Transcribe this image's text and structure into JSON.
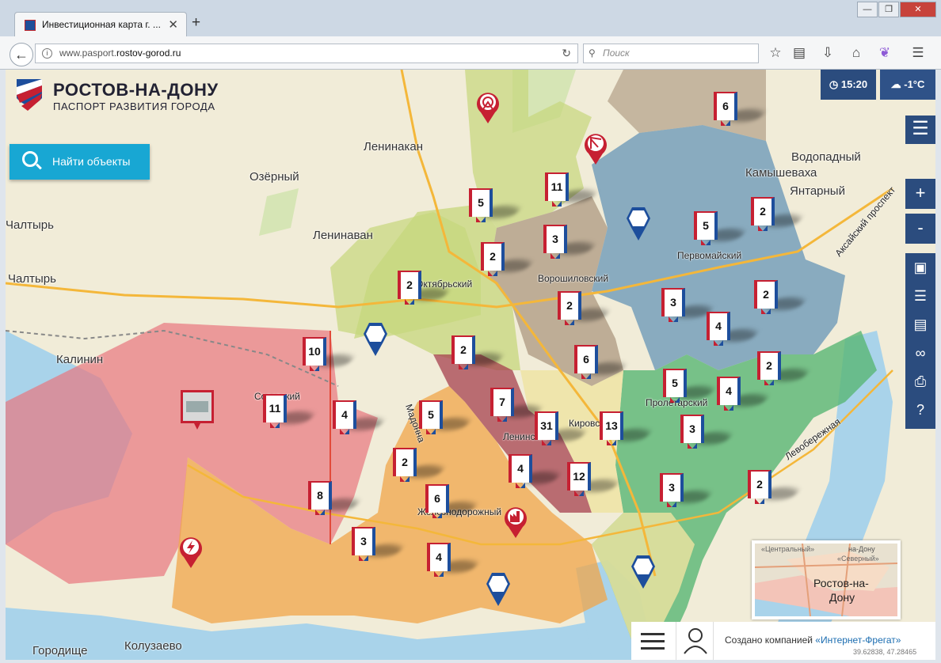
{
  "browser": {
    "tab_title": "Инвестиционная карта г. ...",
    "tab_close": "✕",
    "new_tab": "+",
    "url_prefix": "www.pasport.",
    "url_host": "rostov-gorod.ru",
    "search_placeholder": "Поиск",
    "window_controls": [
      "—",
      "❐",
      "✕"
    ]
  },
  "site": {
    "logo_title": "РОСТОВ-НА-ДОНУ",
    "logo_subtitle": "ПАСПОРТ РАЗВИТИЯ ГОРОДА",
    "find_button": "Найти объекты",
    "time": "15:20",
    "weather": "-1°C",
    "zoom_in": "+",
    "zoom_out": "-",
    "help": "?",
    "credit_prefix": "Создано компанией ",
    "credit_company": "«Интернет-Фрегат»",
    "coordinates": "39.62838, 47.28465"
  },
  "places": [
    {
      "name": "Ленинакан"
    },
    {
      "name": "Озёрный"
    },
    {
      "name": "Чалтырь"
    },
    {
      "name": "Чалтырь"
    },
    {
      "name": "Ленинаван"
    },
    {
      "name": "Калинин"
    },
    {
      "name": "Водопадный"
    },
    {
      "name": "Камышеваха"
    },
    {
      "name": "Янтарный"
    },
    {
      "name": "Первомайский"
    },
    {
      "name": "Ворошиловский"
    },
    {
      "name": "Октябрьский"
    },
    {
      "name": "Советский"
    },
    {
      "name": "Пролетарский"
    },
    {
      "name": "Кировский"
    },
    {
      "name": "Ленинский"
    },
    {
      "name": "Железнодорожный"
    },
    {
      "name": "Мадонна"
    },
    {
      "name": "Колузаево"
    },
    {
      "name": "Городище"
    },
    {
      "name": "Аксайский проспект"
    },
    {
      "name": "Левобережная"
    }
  ],
  "minimap_labels": [
    "«Центральный»",
    "на-Дону",
    "«Северный»",
    "Ростов-на-",
    "Дону"
  ],
  "markers": [
    "6",
    "11",
    "5",
    "3",
    "2",
    "2",
    "2",
    "5",
    "2",
    "2",
    "3",
    "2",
    "4",
    "10",
    "2",
    "6",
    "2",
    "4",
    "11",
    "4",
    "5",
    "7",
    "31",
    "13",
    "5",
    "3",
    "4",
    "2",
    "6",
    "4",
    "12",
    "3",
    "2",
    "8",
    "3",
    "4"
  ]
}
